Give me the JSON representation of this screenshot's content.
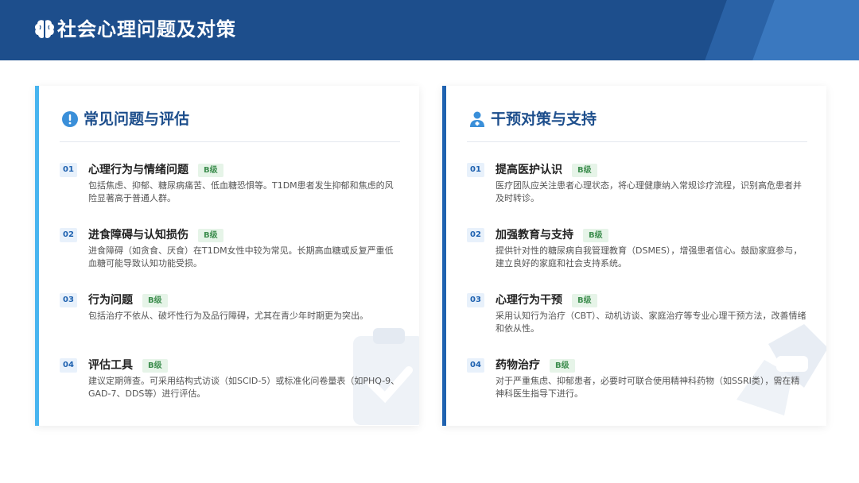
{
  "header": {
    "title": "社会心理问题及对策",
    "icon": "brain-icon"
  },
  "colors": {
    "header_bg": "#1d4e8c",
    "left_accent": "#47b4ef",
    "right_accent": "#1f62b0",
    "badge_bg": "#e6f4e8",
    "badge_text": "#3e8e4f"
  },
  "left": {
    "heading": "常见问题与评估",
    "icon": "exclamation-circle-icon",
    "items": [
      {
        "num": "01",
        "title": "心理行为与情绪问题",
        "badge": "B级",
        "desc": "包括焦虑、抑郁、糖尿病痛苦、低血糖恐惧等。T1DM患者发生抑郁和焦虑的风险显著高于普通人群。"
      },
      {
        "num": "02",
        "title": "进食障碍与认知损伤",
        "badge": "B级",
        "desc": "进食障碍（如贪食、厌食）在T1DM女性中较为常见。长期高血糖或反复严重低血糖可能导致认知功能受损。"
      },
      {
        "num": "03",
        "title": "行为问题",
        "badge": "B级",
        "desc": "包括治疗不依从、破坏性行为及品行障碍，尤其在青少年时期更为突出。"
      },
      {
        "num": "04",
        "title": "评估工具",
        "badge": "B级",
        "desc": "建议定期筛查。可采用结构式访谈（如SCID-5）或标准化问卷量表（如PHQ-9、GAD-7、DDS等）进行评估。"
      }
    ]
  },
  "right": {
    "heading": "干预对策与支持",
    "icon": "doctor-icon",
    "items": [
      {
        "num": "01",
        "title": "提高医护认识",
        "badge": "B级",
        "desc": "医疗团队应关注患者心理状态，将心理健康纳入常规诊疗流程，识别高危患者并及时转诊。"
      },
      {
        "num": "02",
        "title": "加强教育与支持",
        "badge": "B级",
        "desc": "提供针对性的糖尿病自我管理教育（DSMES），增强患者信心。鼓励家庭参与，建立良好的家庭和社会支持系统。"
      },
      {
        "num": "03",
        "title": "心理行为干预",
        "badge": "B级",
        "desc": "采用认知行为治疗（CBT）、动机访谈、家庭治疗等专业心理干预方法，改善情绪和依从性。"
      },
      {
        "num": "04",
        "title": "药物治疗",
        "badge": "B级",
        "desc": "对于严重焦虑、抑郁患者，必要时可联合使用精神科药物（如SSRI类），需在精神科医生指导下进行。"
      }
    ]
  }
}
